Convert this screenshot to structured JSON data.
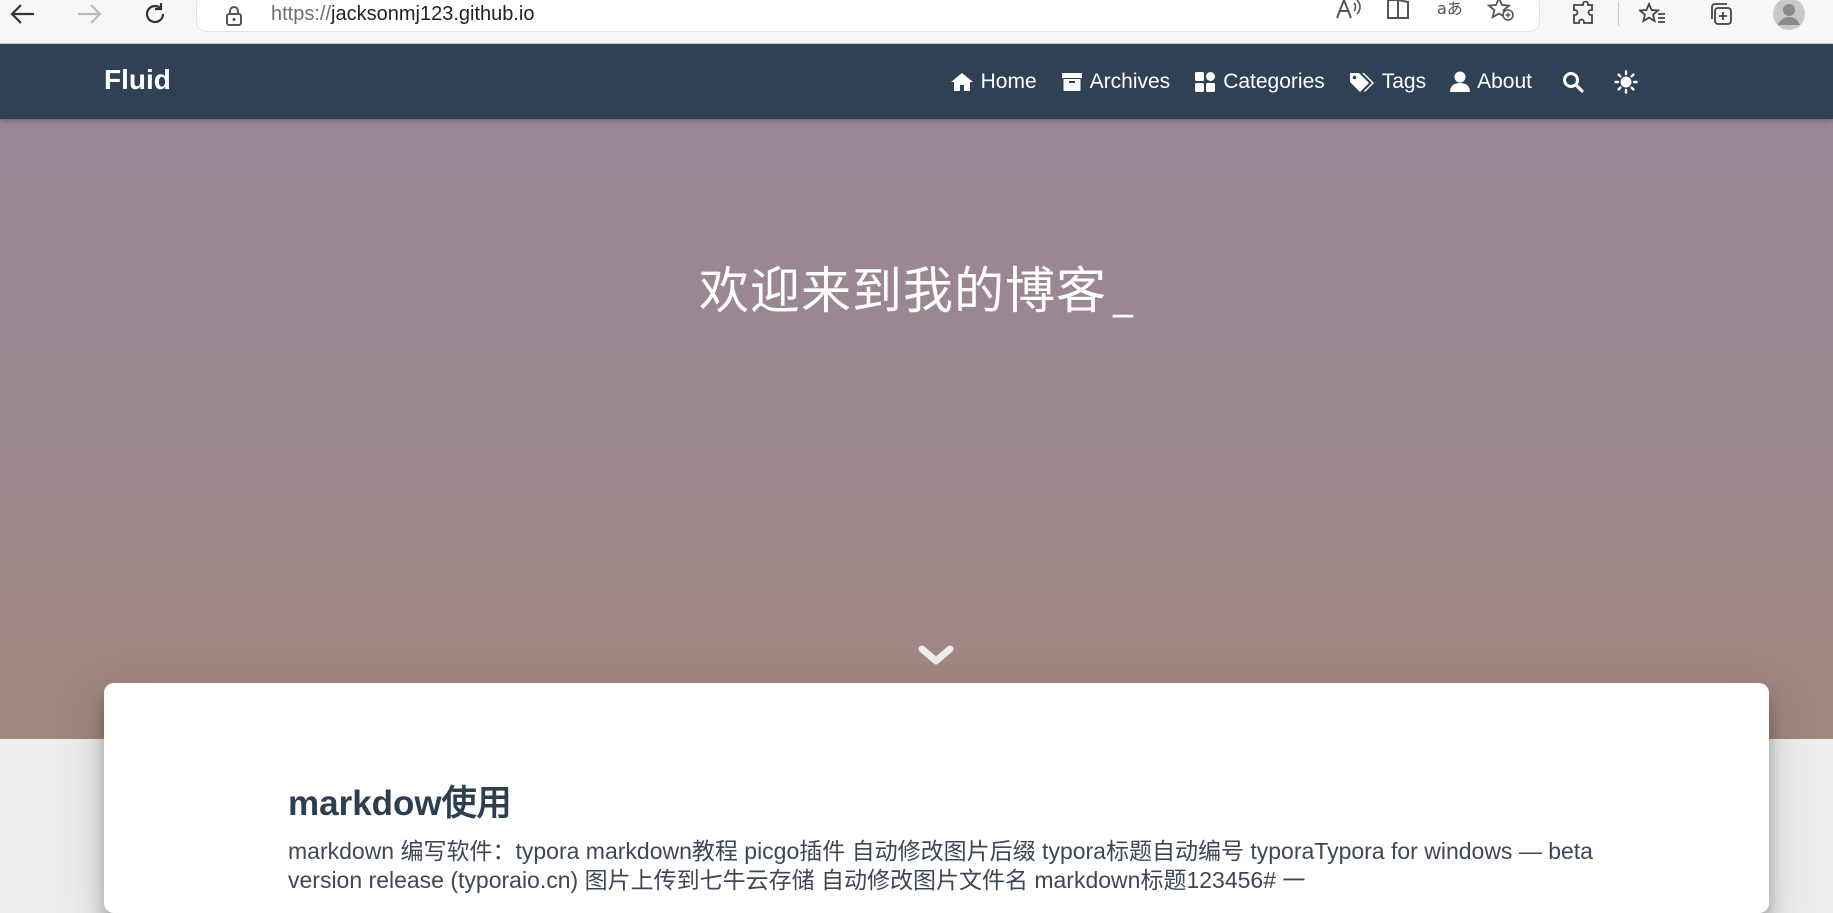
{
  "browser": {
    "url_protocol": "https://",
    "url_host": "jacksonmj123.github.io"
  },
  "navbar": {
    "brand": "Fluid",
    "items": [
      {
        "label": "Home",
        "icon": "home-icon"
      },
      {
        "label": "Archives",
        "icon": "archive-icon"
      },
      {
        "label": "Categories",
        "icon": "categories-icon"
      },
      {
        "label": "Tags",
        "icon": "tags-icon"
      },
      {
        "label": "About",
        "icon": "user-icon"
      }
    ]
  },
  "banner": {
    "title": "欢迎来到我的博客",
    "cursor": "_"
  },
  "post": {
    "title": "markdow使用",
    "excerpt": "markdown 编写软件：typora markdown教程 picgo插件 自动修改图片后缀 typora标题自动编号 typoraTypora for windows — beta version release (typoraio.cn) 图片上传到七牛云存储 自动修改图片文件名 markdown标题123456# 一"
  },
  "colors": {
    "navbar": "#2f4154",
    "banner_top": "#988796",
    "banner_bottom": "#a2877f",
    "post_title": "#2c3e50"
  }
}
